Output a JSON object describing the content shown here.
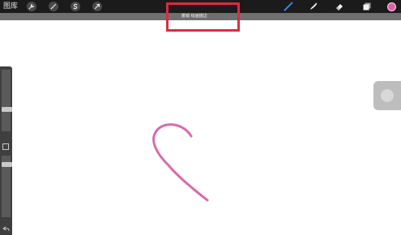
{
  "topbar": {
    "gallery_label": "图库",
    "actions": [
      {
        "name": "wrench-icon",
        "label": "actions"
      },
      {
        "name": "magic-wand-icon",
        "label": "adjustments"
      },
      {
        "name": "selection-s-icon",
        "label": "selection"
      },
      {
        "name": "transform-arrow-icon",
        "label": "transform"
      }
    ],
    "tools": [
      {
        "name": "brush-icon",
        "active": true
      },
      {
        "name": "smudge-icon",
        "active": false
      },
      {
        "name": "eraser-icon",
        "active": false
      },
      {
        "name": "layers-icon",
        "active": false
      }
    ],
    "accent_color": "#3b8bff"
  },
  "hint": {
    "text": "撤销 绘画描边"
  },
  "highlight_color": "#de2a43",
  "color_swatch": "#e35ea8",
  "stroke_color": "#d96aa9"
}
